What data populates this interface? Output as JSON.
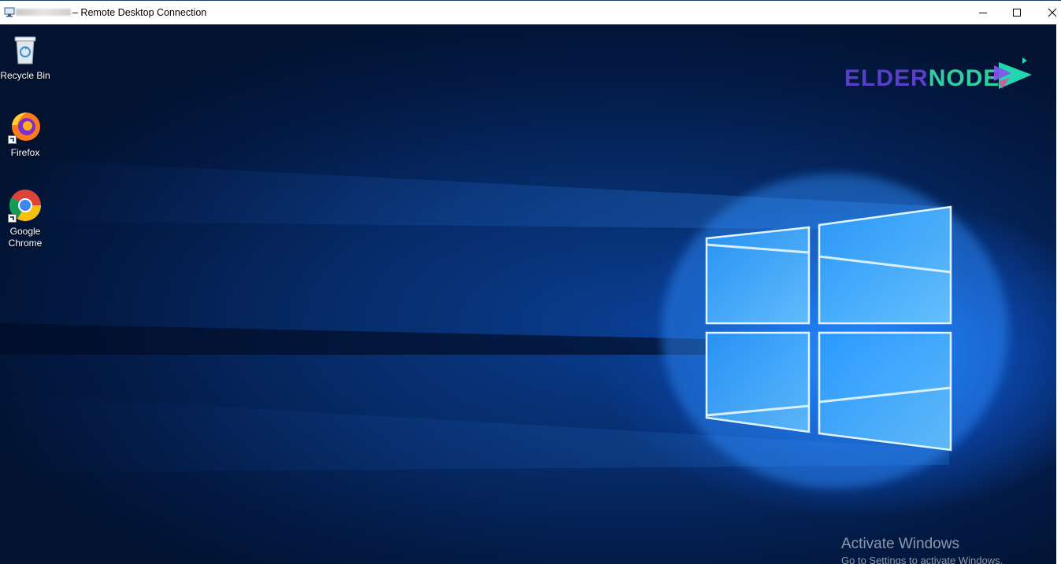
{
  "window": {
    "title": "– Remote Desktop Connection",
    "buttons": {
      "minimize": "minimize-icon",
      "maximize": "maximize-icon",
      "close": "close-icon"
    }
  },
  "desktop": {
    "icons": [
      {
        "label": "Recycle Bin",
        "icon": "recycle-bin-icon"
      },
      {
        "label": "Firefox",
        "icon": "firefox-icon"
      },
      {
        "label": "Google Chrome",
        "icon": "chrome-icon"
      }
    ],
    "brand": {
      "part1": "ELDER",
      "part2": "NODE",
      "colors": {
        "primary": "#5a3ec8",
        "secondary": "#2fd0a0"
      }
    },
    "activation": {
      "line1": "Activate Windows",
      "line2": "Go to Settings to activate Windows."
    }
  },
  "colors": {
    "accent": "#1e90ff",
    "wallpaper_dark": "#031a45"
  }
}
